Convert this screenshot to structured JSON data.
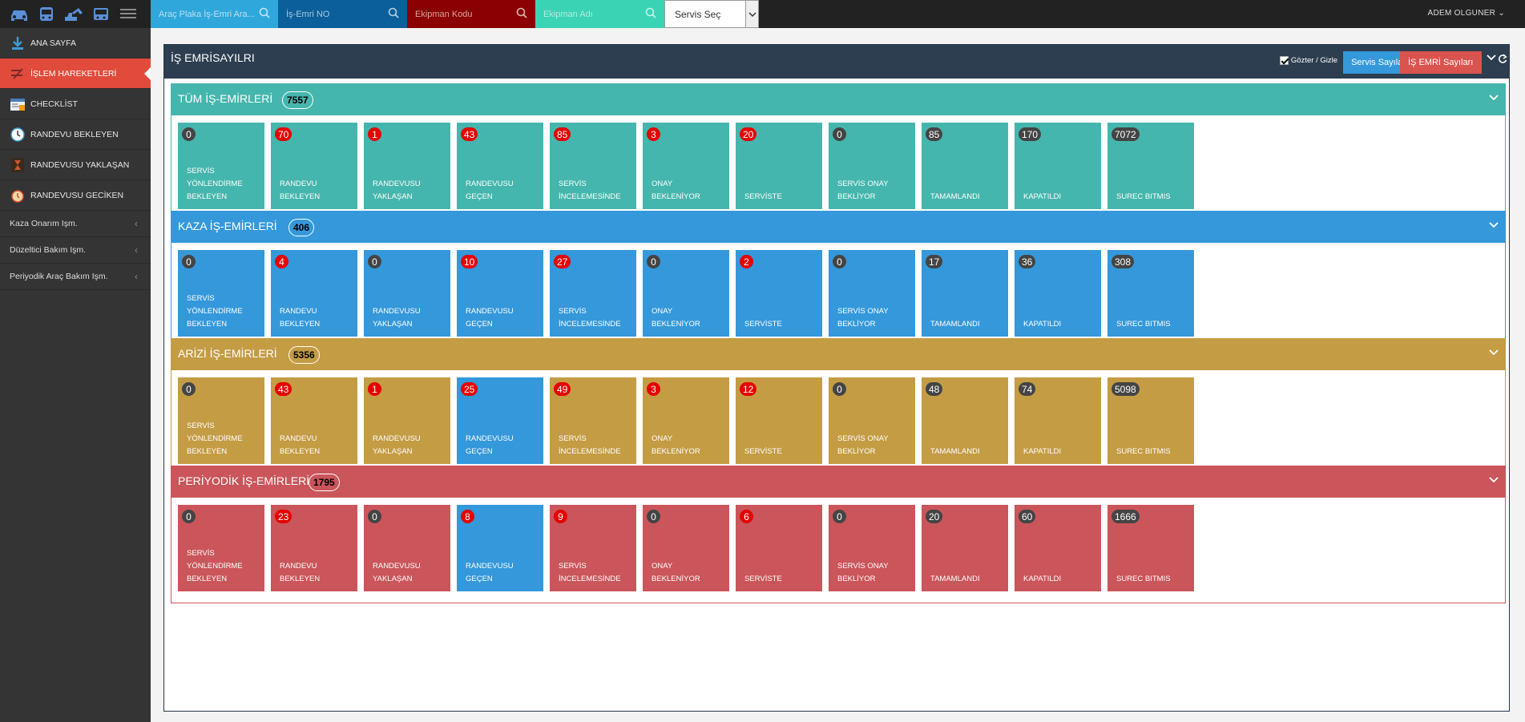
{
  "topbar": {
    "plaka_placeholder": "Araç Plaka İş-Emri Ara...",
    "isemri_placeholder": "İş-Emri NO",
    "ekipman_kodu_placeholder": "Ekipman Kodu",
    "ekipman_adi_placeholder": "Ekipman Adı",
    "servis_select": "Servis Seç",
    "user": "ADEM OLGUNER",
    "colors": {
      "plaka": "#2fa7da",
      "isemri": "#0b5f9b",
      "ekipman_kodu": "#8b0000",
      "ekipman_adi": "#3ad4b5"
    }
  },
  "sidebar": {
    "items": [
      {
        "label": "ANA SAYFA",
        "icon": "download-icon"
      },
      {
        "label": "İŞLEM HAREKETLERİ",
        "icon": "transactions-icon"
      },
      {
        "label": "CHECKLİST",
        "icon": "checklist-icon"
      },
      {
        "label": "RANDEVU BEKLEYEN",
        "icon": "clock-icon"
      },
      {
        "label": "RANDEVUSU YAKLAŞAN",
        "icon": "hourglass-icon"
      },
      {
        "label": "RANDEVUSU GECİKEN",
        "icon": "alarm-icon"
      }
    ],
    "subs": [
      {
        "label": "Kaza Onarım Işm."
      },
      {
        "label": "Düzeltici Bakım Işm."
      },
      {
        "label": "Periyodik Araç Bakım Işm."
      }
    ]
  },
  "panel": {
    "title": "İŞ EMRİSAYILRI",
    "toggle_label": "Gözter / Gizle",
    "servis_btn": "Servis Sayıları",
    "is_btn": "İŞ EMRİ Sayıları"
  },
  "labels": [
    [
      "SERVİS",
      "YÖNLENDİRME",
      "BEKLEYEN"
    ],
    [
      "RANDEVU",
      "BEKLEYEN"
    ],
    [
      "RANDEVUSU",
      "YAKLAŞAN"
    ],
    [
      "RANDEVUSU",
      "GEÇEN"
    ],
    [
      "SERVİS",
      "İNCELEMESİNDE"
    ],
    [
      "ONAY",
      "BEKLENİYOR"
    ],
    [
      "SERVİSTE"
    ],
    [
      "SERVİS ONAY",
      "BEKLİYOR"
    ],
    [
      "TAMAMLANDI"
    ],
    [
      "KAPATILDI"
    ],
    [
      "SUREC BITMIS"
    ]
  ],
  "sections": [
    {
      "title": "TÜM İŞ-EMİRLERİ",
      "count": "7557",
      "color": "#45b6ad",
      "values": [
        "0",
        "70",
        "1",
        "43",
        "85",
        "3",
        "20",
        "0",
        "85",
        "170",
        "7072"
      ]
    },
    {
      "title": "KAZA İŞ-EMİRLERİ",
      "count": "406",
      "color": "#3498db",
      "values": [
        "0",
        "4",
        "0",
        "10",
        "27",
        "0",
        "2",
        "0",
        "17",
        "36",
        "308"
      ]
    },
    {
      "title": "ARİZİ İŞ-EMİRLERİ",
      "count": "5356",
      "color": "#c49c44",
      "values": [
        "0",
        "43",
        "1",
        "25",
        "49",
        "3",
        "12",
        "0",
        "48",
        "74",
        "5098"
      ]
    },
    {
      "title": "PERİYODİK İŞ-EMİRLERİ",
      "count": "1795",
      "color": "#ca555a",
      "values": [
        "0",
        "23",
        "0",
        "8",
        "9",
        "0",
        "6",
        "0",
        "20",
        "60",
        "1666"
      ]
    }
  ],
  "badge_styles": [
    [
      "dark",
      "red",
      "red",
      "red",
      "red",
      "red",
      "red",
      "dark",
      "dark",
      "dark",
      "dark"
    ],
    [
      "dark",
      "red",
      "dark",
      "red",
      "red",
      "dark",
      "red",
      "dark",
      "dark",
      "dark",
      "dark"
    ],
    [
      "dark",
      "red",
      "red",
      "red",
      "red",
      "red",
      "red",
      "dark",
      "dark",
      "dark",
      "dark"
    ],
    [
      "dark",
      "red",
      "dark",
      "red",
      "red",
      "dark",
      "red",
      "dark",
      "dark",
      "dark",
      "dark"
    ]
  ],
  "tile_colors": [
    [
      "#45b6ad",
      "#45b6ad",
      "#45b6ad",
      "#45b6ad",
      "#45b6ad",
      "#45b6ad",
      "#45b6ad",
      "#45b6ad",
      "#45b6ad",
      "#45b6ad",
      "#45b6ad"
    ],
    [
      "#3498db",
      "#3498db",
      "#3498db",
      "#3498db",
      "#3498db",
      "#3498db",
      "#3498db",
      "#3498db",
      "#3498db",
      "#3498db",
      "#3498db"
    ],
    [
      "#c49c44",
      "#c49c44",
      "#c49c44",
      "#3498db",
      "#c49c44",
      "#c49c44",
      "#c49c44",
      "#c49c44",
      "#c49c44",
      "#c49c44",
      "#c49c44"
    ],
    [
      "#ca555a",
      "#ca555a",
      "#ca555a",
      "#3498db",
      "#ca555a",
      "#ca555a",
      "#ca555a",
      "#ca555a",
      "#ca555a",
      "#ca555a",
      "#ca555a"
    ]
  ]
}
